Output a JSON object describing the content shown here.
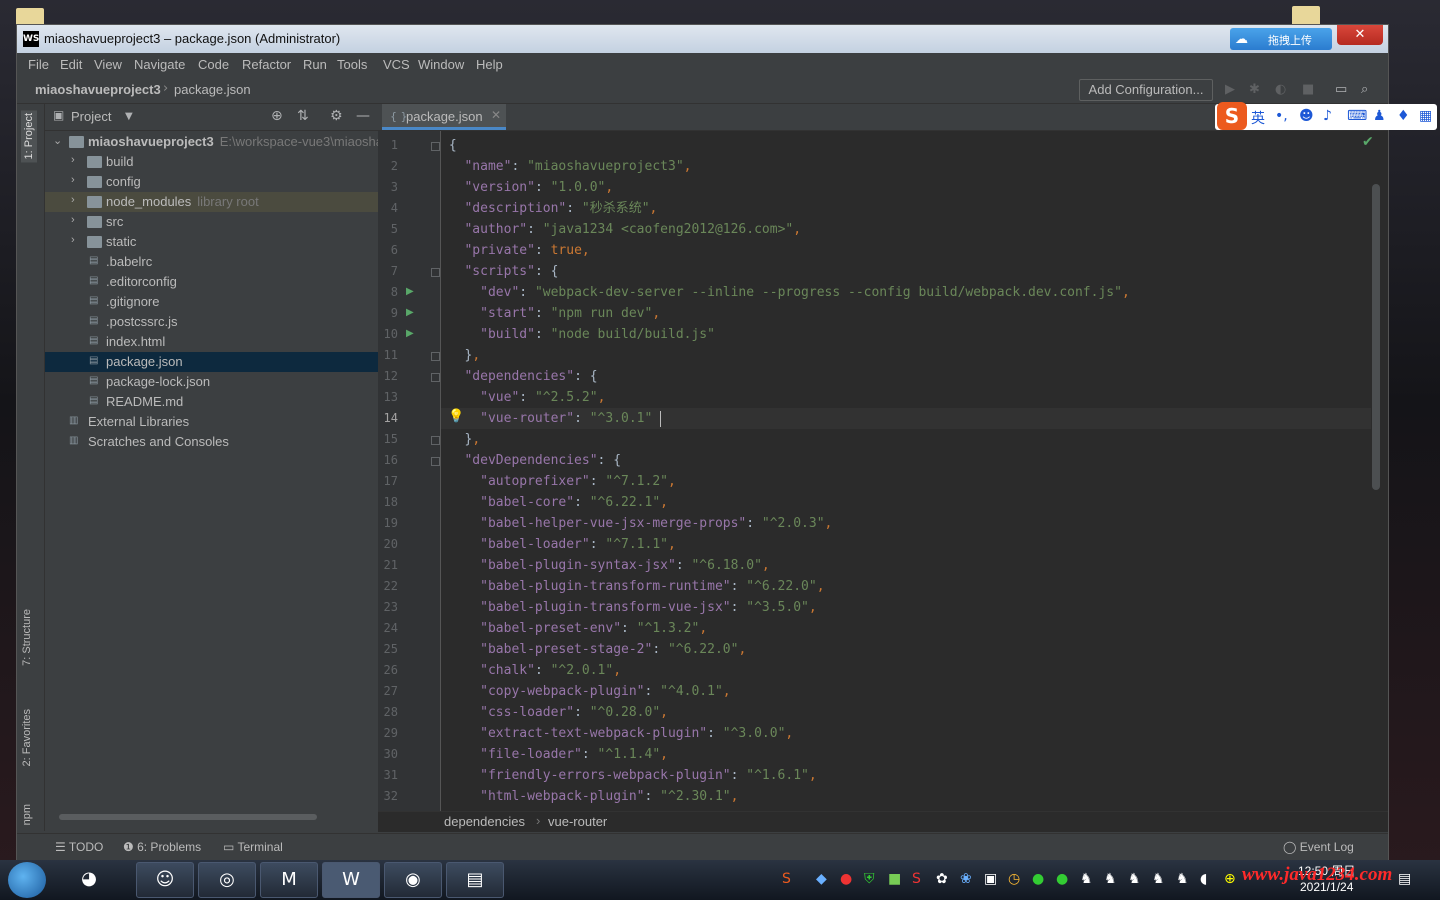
{
  "window": {
    "title": "miaoshavueproject3 – package.json (Administrator)",
    "ide_logo": "WS",
    "upload_widget": "拖拽上传",
    "close": "✕"
  },
  "menu": [
    "File",
    "Edit",
    "View",
    "Navigate",
    "Code",
    "Refactor",
    "Run",
    "Tools",
    "VCS",
    "Window",
    "Help"
  ],
  "navbar": {
    "project": "miaoshavueproject3",
    "file": "package.json",
    "add_config": "Add Configuration..."
  },
  "ime": {
    "logo": "S",
    "lang": "英"
  },
  "left_strip": {
    "project": "1: Project",
    "structure": "7: Structure",
    "favorites": "2: Favorites",
    "npm": "npm"
  },
  "project_panel": {
    "title": "Project",
    "tree": [
      {
        "label": "miaoshavueproject3",
        "extra": "E:\\workspace-vue3\\miaosha",
        "type": "root"
      },
      {
        "label": "build",
        "type": "folder"
      },
      {
        "label": "config",
        "type": "folder"
      },
      {
        "label": "node_modules",
        "extra": "library root",
        "type": "folder"
      },
      {
        "label": "src",
        "type": "folder"
      },
      {
        "label": "static",
        "type": "folder"
      },
      {
        "label": ".babelrc",
        "type": "file"
      },
      {
        "label": ".editorconfig",
        "type": "file"
      },
      {
        "label": ".gitignore",
        "type": "file"
      },
      {
        "label": ".postcssrc.js",
        "type": "file"
      },
      {
        "label": "index.html",
        "type": "file"
      },
      {
        "label": "package.json",
        "type": "file"
      },
      {
        "label": "package-lock.json",
        "type": "file"
      },
      {
        "label": "README.md",
        "type": "file"
      },
      {
        "label": "External Libraries",
        "type": "lib"
      },
      {
        "label": "Scratches and Consoles",
        "type": "lib"
      }
    ]
  },
  "editor": {
    "tab": "package.json",
    "current_line": 14,
    "lines": [
      "{",
      "  \"name\": \"miaoshavueproject3\",",
      "  \"version\": \"1.0.0\",",
      "  \"description\": \"秒杀系统\",",
      "  \"author\": \"java1234 <caofeng2012@126.com>\",",
      "  \"private\": true,",
      "  \"scripts\": {",
      "    \"dev\": \"webpack-dev-server --inline --progress --config build/webpack.dev.conf.js\",",
      "    \"start\": \"npm run dev\",",
      "    \"build\": \"node build/build.js\"",
      "  },",
      "  \"dependencies\": {",
      "    \"vue\": \"^2.5.2\",",
      "    \"vue-router\": \"^3.0.1\"",
      "  },",
      "  \"devDependencies\": {",
      "    \"autoprefixer\": \"^7.1.2\",",
      "    \"babel-core\": \"^6.22.1\",",
      "    \"babel-helper-vue-jsx-merge-props\": \"^2.0.3\",",
      "    \"babel-loader\": \"^7.1.1\",",
      "    \"babel-plugin-syntax-jsx\": \"^6.18.0\",",
      "    \"babel-plugin-transform-runtime\": \"^6.22.0\",",
      "    \"babel-plugin-transform-vue-jsx\": \"^3.5.0\",",
      "    \"babel-preset-env\": \"^1.3.2\",",
      "    \"babel-preset-stage-2\": \"^6.22.0\",",
      "    \"chalk\": \"^2.0.1\",",
      "    \"copy-webpack-plugin\": \"^4.0.1\",",
      "    \"css-loader\": \"^0.28.0\",",
      "    \"extract-text-webpack-plugin\": \"^3.0.0\",",
      "    \"file-loader\": \"^1.1.4\",",
      "    \"friendly-errors-webpack-plugin\": \"^1.6.1\",",
      "    \"html-webpack-plugin\": \"^2.30.1\","
    ],
    "breadcrumb": [
      "dependencies",
      "vue-router"
    ]
  },
  "bottom_bar": {
    "todo": "TODO",
    "problems": "6: Problems",
    "terminal": "Terminal",
    "event_log": "Event Log"
  },
  "taskbar": {
    "time": "12:50 周日",
    "date": "2021/1/24",
    "watermark": "www.java1234.com"
  },
  "colors": {
    "ide_bg": "#2b2b2b",
    "panel_bg": "#3c3f41",
    "key": "#9876aa",
    "string": "#6a8759",
    "keyword": "#cc7832",
    "selection": "#0d293e"
  }
}
